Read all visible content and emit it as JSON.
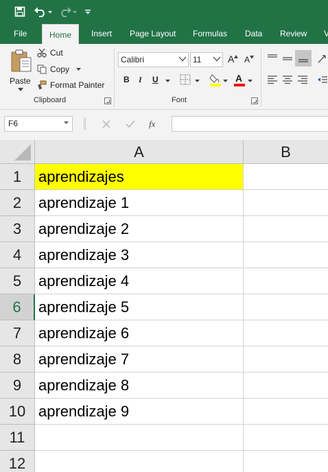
{
  "qat": {
    "icons": {
      "save": "save-icon",
      "undo": "undo-icon",
      "redo": "redo-icon",
      "customize": "chevron-down-icon"
    }
  },
  "tabs": [
    "File",
    "Home",
    "Insert",
    "Page Layout",
    "Formulas",
    "Data",
    "Review",
    "V"
  ],
  "active_tab": "Home",
  "clipboard": {
    "paste_label": "Paste",
    "cut_label": "Cut",
    "copy_label": "Copy",
    "format_painter_label": "Format Painter",
    "group_label": "Clipboard"
  },
  "font": {
    "family": "Calibri",
    "size": "11",
    "grow_label": "A",
    "shrink_label": "A",
    "bold_label": "B",
    "italic_label": "I",
    "underline_label": "U",
    "font_color_label": "A",
    "group_label": "Font",
    "colors": {
      "highlight": "#ffff00",
      "font_color": "#ff0000"
    }
  },
  "formula_bar": {
    "name_box": "F6",
    "fx_label": "fx",
    "value": ""
  },
  "sheet": {
    "columns": [
      "A",
      "B"
    ],
    "rows": [
      {
        "num": "1",
        "a": "aprendizajes"
      },
      {
        "num": "2",
        "a": "aprendizaje 1"
      },
      {
        "num": "3",
        "a": "aprendizaje 2"
      },
      {
        "num": "4",
        "a": "aprendizaje 3"
      },
      {
        "num": "5",
        "a": "aprendizaje 4"
      },
      {
        "num": "6",
        "a": "aprendizaje 5"
      },
      {
        "num": "7",
        "a": "aprendizaje 6"
      },
      {
        "num": "8",
        "a": "aprendizaje 7"
      },
      {
        "num": "9",
        "a": "aprendizaje 8"
      },
      {
        "num": "10",
        "a": "aprendizaje 9"
      },
      {
        "num": "11",
        "a": ""
      },
      {
        "num": "12",
        "a": ""
      }
    ],
    "selected_row": "6",
    "highlight_fill": "#ffff00",
    "accent": "#217346"
  }
}
